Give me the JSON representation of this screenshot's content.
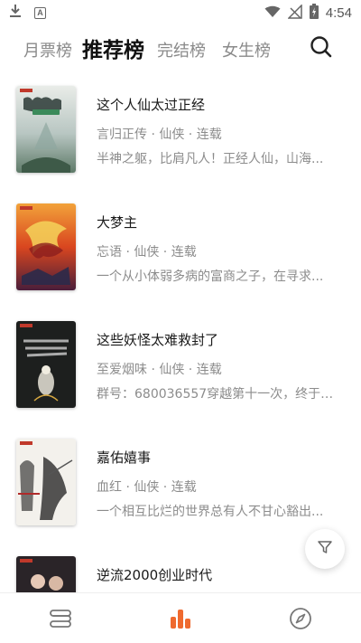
{
  "status_bar": {
    "time": "4:54",
    "left_icons": [
      "download-icon",
      "a-badge-icon"
    ],
    "right_icons": [
      "wifi-icon",
      "no-signal-icon",
      "battery-charging-icon"
    ]
  },
  "tabs": [
    {
      "label": "月票榜",
      "active": false
    },
    {
      "label": "推荐榜",
      "active": true
    },
    {
      "label": "完结榜",
      "active": false
    },
    {
      "label": "女生榜",
      "active": false
    }
  ],
  "books": [
    {
      "title": "这个人仙太过正经",
      "meta": "言归正传 · 仙侠 · 连载",
      "desc": "半神之躯，比肩凡人！正经人仙，山海..."
    },
    {
      "title": "大梦主",
      "meta": "忘语 · 仙侠 · 连载",
      "desc": "一个从小体弱多病的富商之子，在寻求..."
    },
    {
      "title": "这些妖怪太难救封了",
      "meta": "至爱烟味 · 仙侠 · 连载",
      "desc": "群号：680036557穿越第十一次，终于来..."
    },
    {
      "title": "嘉佑嬉事",
      "meta": "血红 · 仙侠 · 连载",
      "desc": "一个相互比烂的世界总有人不甘心豁出..."
    },
    {
      "title": "逆流2000创业时代",
      "meta": "",
      "desc": ""
    }
  ],
  "bottom_nav": [
    {
      "icon": "bookshelf-icon",
      "active": false
    },
    {
      "icon": "ranking-icon",
      "active": true
    },
    {
      "icon": "compass-icon",
      "active": false
    }
  ],
  "colors": {
    "accent": "#ef6a2f",
    "text_primary": "#1a1a1a",
    "text_secondary": "#8c8c8c",
    "icon_inactive": "#777777"
  }
}
